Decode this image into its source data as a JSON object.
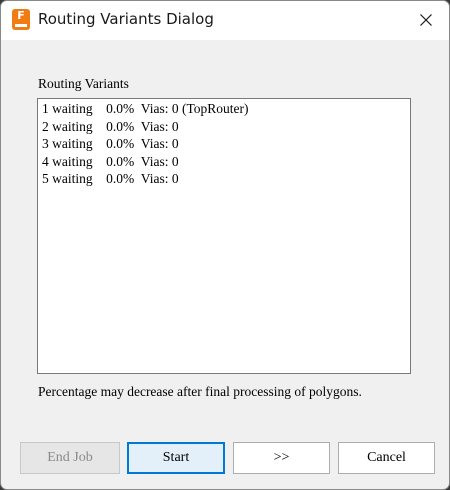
{
  "window": {
    "title": "Routing Variants Dialog",
    "app_icon_letter": "F",
    "app_icon_color": "#f07c13"
  },
  "group": {
    "label": "Routing Variants"
  },
  "variants": [
    {
      "number": "1",
      "status": "waiting",
      "percent": "0.0%",
      "vias": "Vias: 0",
      "note": "(TopRouter)"
    },
    {
      "number": "2",
      "status": "waiting",
      "percent": "0.0%",
      "vias": "Vias: 0",
      "note": ""
    },
    {
      "number": "3",
      "status": "waiting",
      "percent": "0.0%",
      "vias": "Vias: 0",
      "note": ""
    },
    {
      "number": "4",
      "status": "waiting",
      "percent": "0.0%",
      "vias": "Vias: 0",
      "note": ""
    },
    {
      "number": "5",
      "status": "waiting",
      "percent": "0.0%",
      "vias": "Vias: 0",
      "note": ""
    }
  ],
  "note_text": "Percentage may decrease after final processing of polygons.",
  "buttons": {
    "end_job": "End Job",
    "start": "Start",
    "next": ">>",
    "cancel": "Cancel"
  },
  "icons": {
    "close": "close-icon",
    "app": "app-icon"
  },
  "colors": {
    "accent": "#0078d7",
    "default_button_bg": "#e3f0fa",
    "disabled_text": "#8a8a8a"
  }
}
